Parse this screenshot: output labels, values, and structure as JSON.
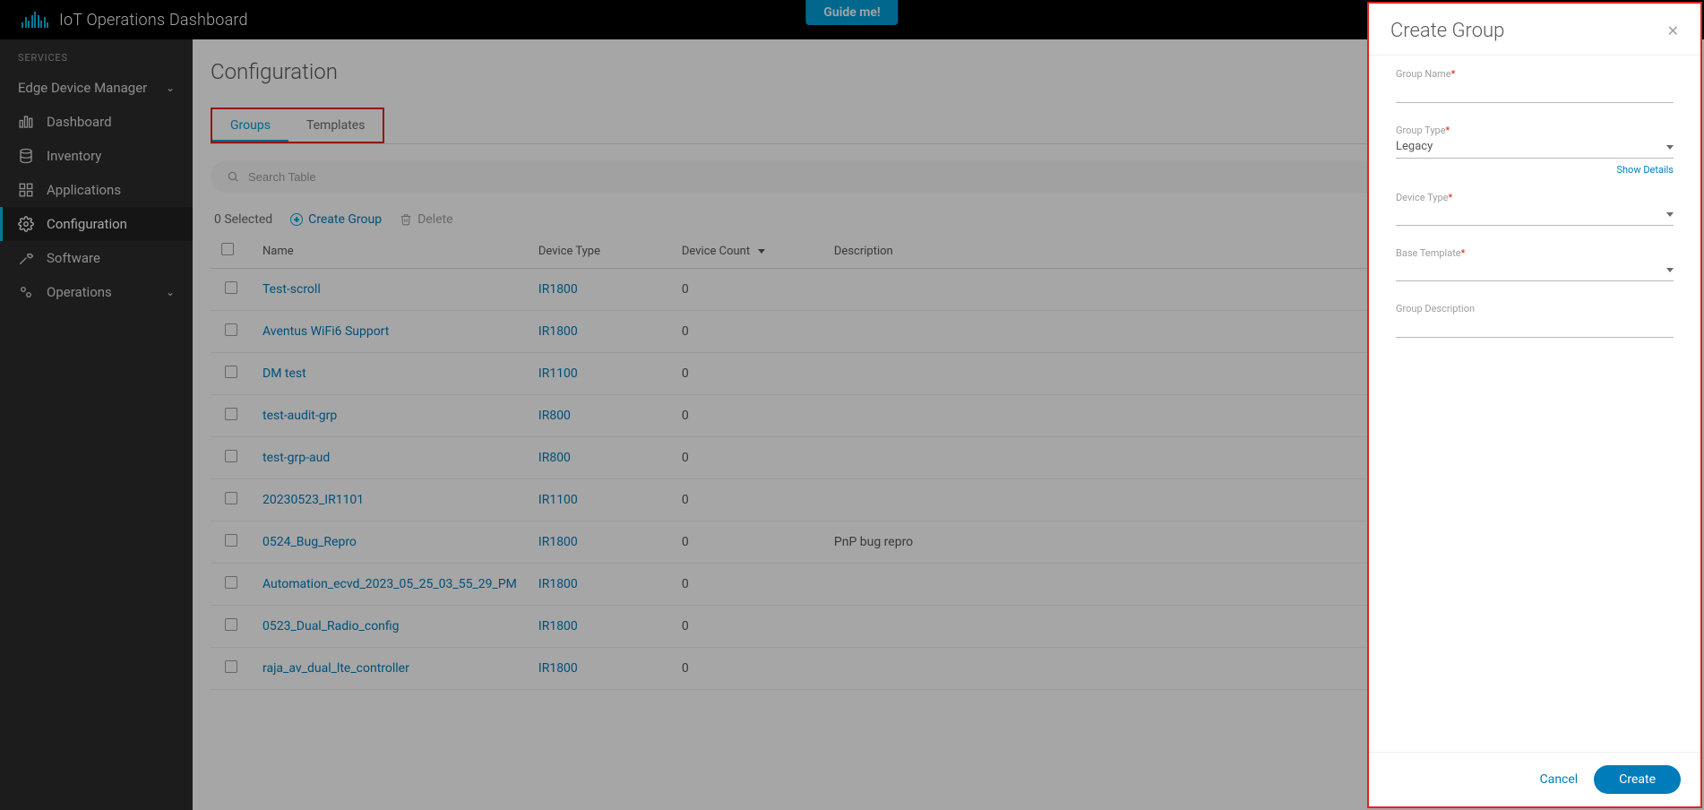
{
  "header": {
    "app_title": "IoT Operations Dashboard",
    "guide_btn": "Guide me!"
  },
  "sidebar": {
    "services_label": "SERVICES",
    "section_label": "Edge Device Manager",
    "items": [
      {
        "label": "Dashboard"
      },
      {
        "label": "Inventory"
      },
      {
        "label": "Applications"
      },
      {
        "label": "Configuration"
      },
      {
        "label": "Software"
      },
      {
        "label": "Operations"
      }
    ]
  },
  "page": {
    "title": "Configuration",
    "tabs": {
      "groups": "Groups",
      "templates": "Templates"
    },
    "search_placeholder": "Search Table",
    "toolbar": {
      "selected": "0 Selected",
      "create_group": "Create Group",
      "delete": "Delete"
    },
    "columns": {
      "name": "Name",
      "device_type": "Device Type",
      "device_count": "Device Count",
      "description": "Description"
    },
    "rows": [
      {
        "name": "Test-scroll",
        "type": "IR1800",
        "count": "0",
        "desc": ""
      },
      {
        "name": "Aventus WiFi6 Support",
        "type": "IR1800",
        "count": "0",
        "desc": ""
      },
      {
        "name": "DM test",
        "type": "IR1100",
        "count": "0",
        "desc": ""
      },
      {
        "name": "test-audit-grp",
        "type": "IR800",
        "count": "0",
        "desc": ""
      },
      {
        "name": "test-grp-aud",
        "type": "IR800",
        "count": "0",
        "desc": ""
      },
      {
        "name": "20230523_IR1101",
        "type": "IR1100",
        "count": "0",
        "desc": ""
      },
      {
        "name": "0524_Bug_Repro",
        "type": "IR1800",
        "count": "0",
        "desc": "PnP bug repro"
      },
      {
        "name": "Automation_ecvd_2023_05_25_03_55_29_PM",
        "type": "IR1800",
        "count": "0",
        "desc": ""
      },
      {
        "name": "0523_Dual_Radio_config",
        "type": "IR1800",
        "count": "0",
        "desc": ""
      },
      {
        "name": "raja_av_dual_lte_controller",
        "type": "IR1800",
        "count": "0",
        "desc": ""
      }
    ]
  },
  "drawer": {
    "title": "Create Group",
    "labels": {
      "group_name": "Group Name",
      "group_type": "Group Type",
      "device_type": "Device Type",
      "base_template": "Base Template",
      "group_description": "Group Description",
      "show_details": "Show Details"
    },
    "values": {
      "group_type": "Legacy"
    },
    "buttons": {
      "cancel": "Cancel",
      "create": "Create"
    },
    "required_marker": "*"
  },
  "colors": {
    "accent_blue": "#049fd9",
    "link_blue": "#007cba",
    "cisco_red": "#e2231a"
  }
}
